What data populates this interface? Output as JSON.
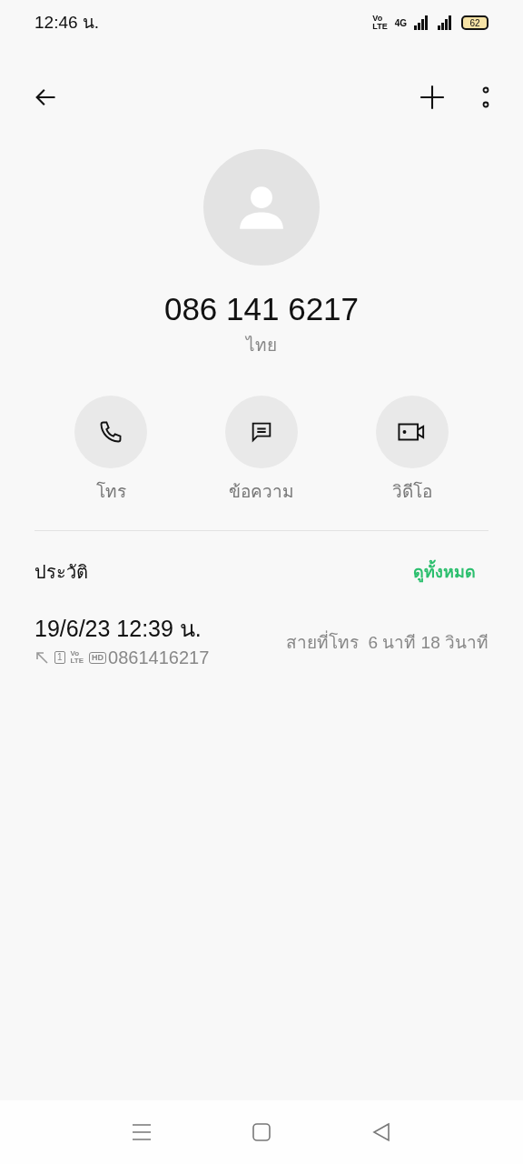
{
  "status_bar": {
    "time": "12:46 น.",
    "volte": [
      "Vo",
      "LTE"
    ],
    "network": "4G",
    "battery": "62"
  },
  "contact": {
    "number": "086 141 6217",
    "location": "ไทย"
  },
  "actions": [
    {
      "kind": "call",
      "label": "โทร"
    },
    {
      "kind": "message",
      "label": "ข้อความ"
    },
    {
      "kind": "video",
      "label": "วิดีโอ"
    }
  ],
  "history": {
    "title": "ประวัติ",
    "see_all": "ดูทั้งหมด",
    "entries": [
      {
        "datetime": "19/6/23 12:39 น.",
        "sim": "1",
        "volte": [
          "Vo",
          "LTE"
        ],
        "hd": "HD",
        "number": "0861416217",
        "summary": "สายที่โทร  6 นาที 18 วินาที"
      }
    ]
  }
}
